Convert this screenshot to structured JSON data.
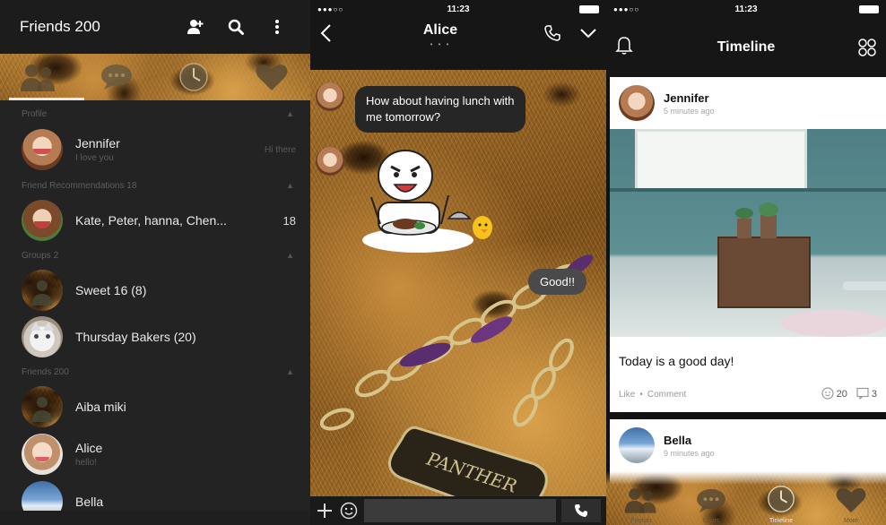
{
  "friends_panel": {
    "header": {
      "title": "Friends 200"
    },
    "sections": {
      "profile": "Profile",
      "recommendations": "Friend Recommendations 18",
      "groups": "Groups 2",
      "friends": "Friends 200"
    },
    "profile": {
      "name": "Jennifer",
      "status": "I love you",
      "right_text": "Hi there"
    },
    "recommendations": {
      "names": "Kate, Peter, hanna, Chen...",
      "count": "18"
    },
    "groups": [
      {
        "name": "Sweet 16 (8)"
      },
      {
        "name": "Thursday Bakers (20)"
      }
    ],
    "friends": [
      {
        "name": "Aiba miki",
        "status": ""
      },
      {
        "name": "Alice",
        "status": "hello!"
      },
      {
        "name": "Bella",
        "status": ""
      }
    ]
  },
  "chat_panel": {
    "status_time": "11:23",
    "signal": "●●●○○",
    "title": "Alice",
    "page_dots": "• • •",
    "messages": {
      "incoming": "How about having lunch with me tomorrow?",
      "outgoing": "Good!!"
    },
    "sticker": "lunch-sticker",
    "jewelry_text": "PANTHER"
  },
  "timeline_panel": {
    "status_time": "11:23",
    "signal": "●●●○○",
    "title": "Timeline",
    "posts": [
      {
        "author": "Jennifer",
        "time": "5 minutes ago",
        "caption": "Today is a good day!",
        "like": "Like",
        "comment": "Comment",
        "sticker_count": "20",
        "comment_count": "3"
      },
      {
        "author": "Bella",
        "time": "9 minutes ago"
      }
    ],
    "tabs": [
      {
        "label": "Friends",
        "icon": "friends-icon"
      },
      {
        "label": "Chats",
        "icon": "chat-bubble-icon"
      },
      {
        "label": "Timeline",
        "icon": "clock-icon"
      },
      {
        "label": "More",
        "icon": "heart-icon"
      }
    ]
  },
  "colors": {
    "dark_panel": "#232323",
    "header_black": "#161616",
    "fur_gold": "#b07a30",
    "text_white": "#ffffff"
  }
}
